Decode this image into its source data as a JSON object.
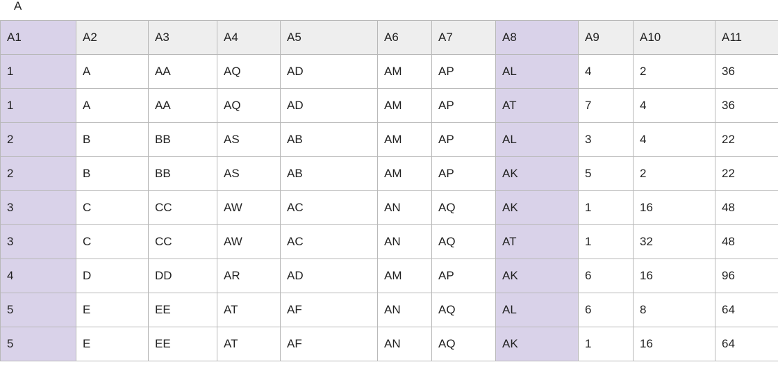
{
  "caption": "A",
  "table": {
    "headers": [
      "A1",
      "A2",
      "A3",
      "A4",
      "A5",
      "A6",
      "A7",
      "A8",
      "A9",
      "A10",
      "A11"
    ],
    "highlighted_columns": [
      "A1",
      "A8"
    ],
    "highlight_color": "#d9d2e9",
    "header_color": "#eeeeee",
    "rows": [
      [
        "1",
        "A",
        "AA",
        "AQ",
        "AD",
        "AM",
        "AP",
        "AL",
        "4",
        "2",
        "36"
      ],
      [
        "1",
        "A",
        "AA",
        "AQ",
        "AD",
        "AM",
        "AP",
        "AT",
        "7",
        "4",
        "36"
      ],
      [
        "2",
        "B",
        "BB",
        "AS",
        "AB",
        "AM",
        "AP",
        "AL",
        "3",
        "4",
        "22"
      ],
      [
        "2",
        "B",
        "BB",
        "AS",
        "AB",
        "AM",
        "AP",
        "AK",
        "5",
        "2",
        "22"
      ],
      [
        "3",
        "C",
        "CC",
        "AW",
        "AC",
        "AN",
        "AQ",
        "AK",
        "1",
        "16",
        "48"
      ],
      [
        "3",
        "C",
        "CC",
        "AW",
        "AC",
        "AN",
        "AQ",
        "AT",
        "1",
        "32",
        "48"
      ],
      [
        "4",
        "D",
        "DD",
        "AR",
        "AD",
        "AM",
        "AP",
        "AK",
        "6",
        "16",
        "96"
      ],
      [
        "5",
        "E",
        "EE",
        "AT",
        "AF",
        "AN",
        "AQ",
        "AL",
        "6",
        "8",
        "64"
      ],
      [
        "5",
        "E",
        "EE",
        "AT",
        "AF",
        "AN",
        "AQ",
        "AK",
        "1",
        "16",
        "64"
      ]
    ]
  }
}
